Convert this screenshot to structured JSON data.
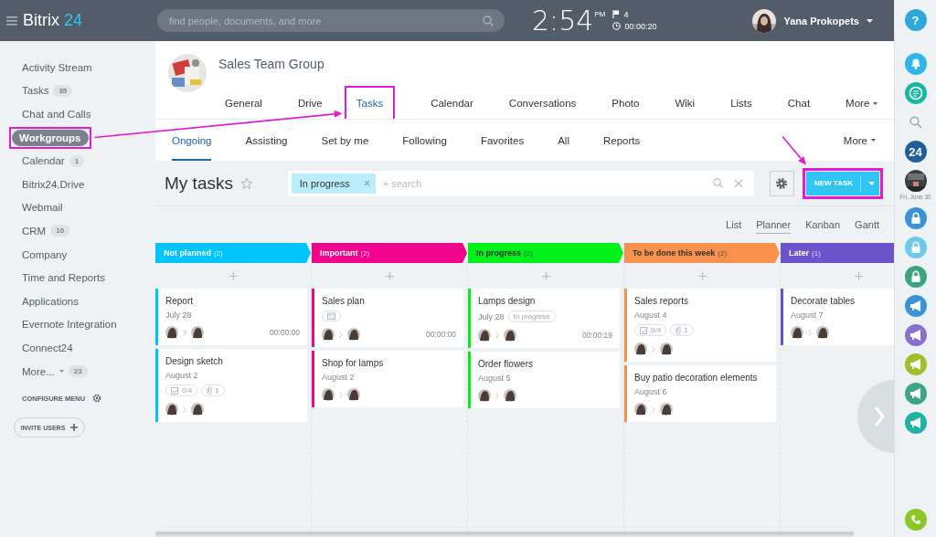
{
  "header": {
    "help": "?",
    "logo_text": "Bitrix",
    "logo_number": "24",
    "search": {
      "placeholder": "find people, documents, and more"
    },
    "time": "2:54",
    "ampm": "PM",
    "flag_count": "4",
    "timer": "00:00:20",
    "user_name": "Yana Prokopets"
  },
  "sidebar": {
    "items": [
      {
        "label": "Activity Stream",
        "selected": false
      },
      {
        "label": "Tasks",
        "counter": "35",
        "selected": false
      },
      {
        "label": "Chat and Calls",
        "selected": false
      },
      {
        "label": "Workgroups",
        "selected": true,
        "highlighted": true
      },
      {
        "label": "Calendar",
        "counter": "1",
        "selected": false
      },
      {
        "label": "Bitrix24.Drive",
        "selected": false
      },
      {
        "label": "Webmail",
        "selected": false
      },
      {
        "label": "CRM",
        "counter": "10",
        "selected": false
      },
      {
        "label": "Company",
        "selected": false
      },
      {
        "label": "Time and Reports",
        "selected": false
      },
      {
        "label": "Applications",
        "selected": false
      },
      {
        "label": "Evernote Integration",
        "selected": false
      },
      {
        "label": "Connect24",
        "selected": false
      },
      {
        "label": "More...",
        "counter": "23",
        "selected": false,
        "dropdown": true
      }
    ],
    "configure": "CONFIGURE MENU",
    "invite": "INVITE USERS"
  },
  "group": {
    "title": "Sales Team Group",
    "tabs": [
      {
        "label": "General",
        "selected": false
      },
      {
        "label": "Drive",
        "selected": false
      },
      {
        "label": "Tasks",
        "selected": true,
        "highlighted": true
      },
      {
        "label": "Calendar",
        "selected": false
      },
      {
        "label": "Conversations",
        "selected": false
      },
      {
        "label": "Photo",
        "selected": false
      },
      {
        "label": "Wiki",
        "selected": false
      },
      {
        "label": "Lists",
        "selected": false
      },
      {
        "label": "Chat",
        "selected": false
      },
      {
        "label": "More",
        "selected": false,
        "dropdown": true
      }
    ]
  },
  "subtabs": [
    {
      "label": "Ongoing",
      "selected": true
    },
    {
      "label": "Assisting",
      "selected": false
    },
    {
      "label": "Set by me",
      "selected": false
    },
    {
      "label": "Following",
      "selected": false
    },
    {
      "label": "Favorites",
      "selected": false
    },
    {
      "label": "All",
      "selected": false
    },
    {
      "label": "Reports",
      "selected": false
    },
    {
      "label": "More",
      "selected": false,
      "dropdown": true
    }
  ],
  "toolbar": {
    "title": "My tasks",
    "filter_tag": "In progress",
    "search_placeholder": "+ search",
    "new_task": "NEW TASK",
    "new_task_highlighted": true
  },
  "views": [
    {
      "label": "List",
      "selected": false
    },
    {
      "label": "Planner",
      "selected": true
    },
    {
      "label": "Kanban",
      "selected": false
    },
    {
      "label": "Gantt",
      "selected": false
    }
  ],
  "columns": [
    {
      "name": "Not planned",
      "count": "(2)",
      "color": "#00c4fb",
      "cards": [
        {
          "title": "Report",
          "date": "July 28",
          "timer": "00:00:00"
        },
        {
          "title": "Design sketch",
          "date": "August 2",
          "checklist": "0/4",
          "files": "1"
        }
      ]
    },
    {
      "name": "Important",
      "count": "(2)",
      "color": "#f0058c",
      "cards": [
        {
          "title": "Sales plan",
          "calendar_chip": true,
          "timer": "00:00:00"
        },
        {
          "title": "Shop for lamps",
          "date": "August 2"
        }
      ]
    },
    {
      "name": "In progress",
      "count": "(2)",
      "color": "#00f01a",
      "dark_text": true,
      "cards": [
        {
          "title": "Lamps design",
          "date": "July 28",
          "status": "In progress",
          "timer": "00:00:19"
        },
        {
          "title": "Order flowers",
          "date": "August 5"
        }
      ]
    },
    {
      "name": "To be done this week",
      "count": "(2)",
      "color": "#f8914b",
      "dark_text": true,
      "cards": [
        {
          "title": "Sales reports",
          "date": "August 4",
          "checklist": "0/4",
          "files": "1"
        },
        {
          "title": "Buy patio decoration elements",
          "date": "August 6"
        }
      ]
    },
    {
      "name": "Later",
      "count": "(1)",
      "color": "#6b53cc",
      "cards": [
        {
          "title": "Decorate tables",
          "date": "August 7"
        }
      ]
    }
  ],
  "right_bar": {
    "logo_number": "24",
    "date": "Fri, June 30",
    "items": [
      {
        "kind": "lock",
        "color": "#3a93d8"
      },
      {
        "kind": "lock",
        "color": "#6ccbec"
      },
      {
        "kind": "lock",
        "color": "#3aa57a"
      },
      {
        "kind": "megaphone",
        "color": "#3a93d8"
      },
      {
        "kind": "megaphone",
        "color": "#8a6fd0"
      },
      {
        "kind": "megaphone",
        "color": "#a4be2a"
      },
      {
        "kind": "megaphone",
        "color": "#3da57f"
      },
      {
        "kind": "megaphone",
        "color": "#1fb3a8"
      }
    ]
  }
}
